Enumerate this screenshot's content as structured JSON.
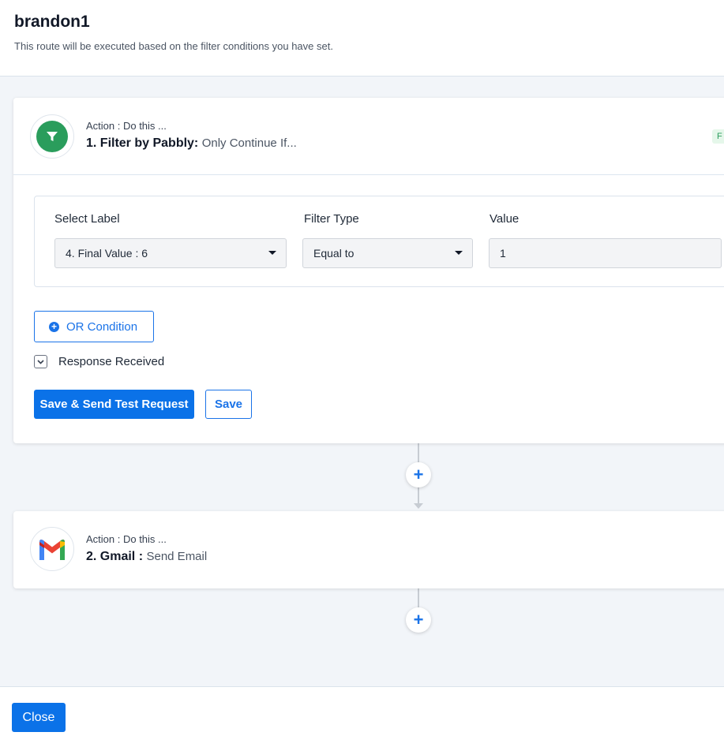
{
  "header": {
    "title": "brandon1",
    "subtitle": "This route will be executed based on the filter conditions you have set."
  },
  "steps": [
    {
      "action_line": "Action : Do this ...",
      "title": "1. Filter by Pabbly:",
      "subtitle": "Only Continue If...",
      "icon": "filter-icon",
      "badge": "F",
      "filter": {
        "select_label_heading": "Select Label",
        "filter_type_heading": "Filter Type",
        "value_heading": "Value",
        "select_label_value": "4. Final Value : 6",
        "filter_type_value": "Equal to",
        "value": "1"
      },
      "or_condition_label": "OR Condition",
      "response_label": "Response Received",
      "save_test_label": "Save & Send Test Request",
      "save_label": "Save"
    },
    {
      "action_line": "Action : Do this ...",
      "title": "2. Gmail :",
      "subtitle": "Send Email",
      "icon": "gmail-icon"
    }
  ],
  "connectors": {
    "add_symbol": "+"
  },
  "footer": {
    "close_label": "Close"
  },
  "colors": {
    "primary": "#0b72e8",
    "filter_green": "#2a9d5c"
  }
}
